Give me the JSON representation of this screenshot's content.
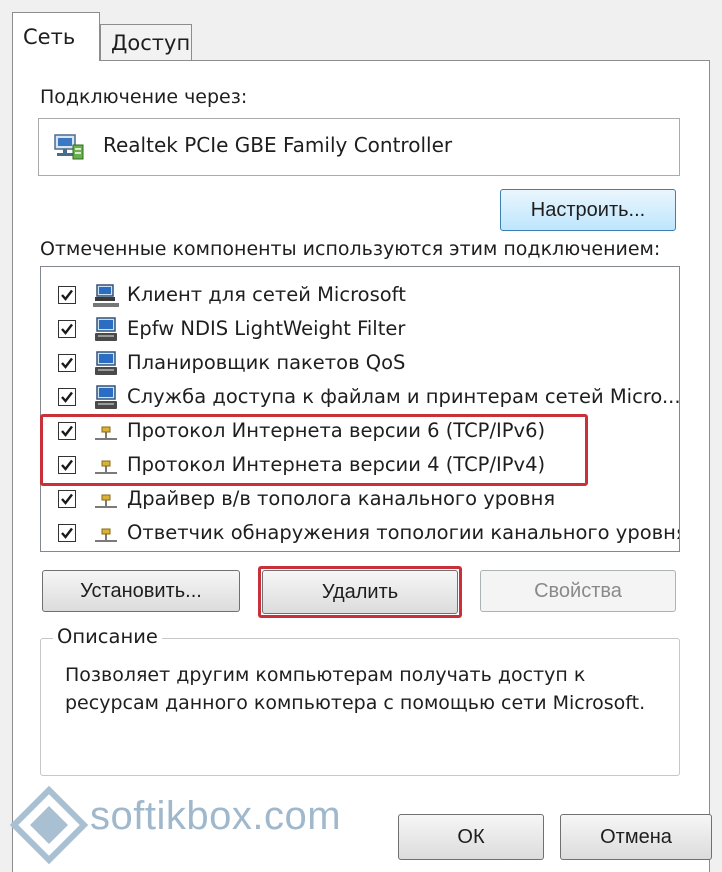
{
  "tabs": [
    {
      "label": "Сеть",
      "active": true
    },
    {
      "label": "Доступ",
      "active": false
    }
  ],
  "connect_using_label": "Подключение через:",
  "adapter": {
    "name": "Realtek PCIe GBE Family Controller",
    "icon": "network-adapter-icon"
  },
  "configure_button": "Настроить...",
  "components_label": "Отмеченные компоненты используются этим подключением:",
  "components": [
    {
      "label": "Клиент для сетей Microsoft",
      "checked": true,
      "icon": "network-client-icon"
    },
    {
      "label": "Epfw NDIS LightWeight Filter",
      "checked": true,
      "icon": "network-service-icon"
    },
    {
      "label": "Планировщик пакетов QoS",
      "checked": true,
      "icon": "network-service-icon"
    },
    {
      "label": "Служба доступа к файлам и принтерам сетей Micro...",
      "checked": true,
      "icon": "network-service-icon"
    },
    {
      "label": "Протокол Интернета версии 6 (TCP/IPv6)",
      "checked": true,
      "icon": "protocol-icon"
    },
    {
      "label": "Протокол Интернета версии 4 (TCP/IPv4)",
      "checked": true,
      "icon": "protocol-icon"
    },
    {
      "label": "Драйвер в/в тополога канального уровня",
      "checked": true,
      "icon": "protocol-icon"
    },
    {
      "label": "Ответчик обнаружения топологии канального уровня",
      "checked": true,
      "icon": "protocol-icon"
    }
  ],
  "buttons": {
    "install": "Установить...",
    "uninstall": "Удалить",
    "properties": "Свойства",
    "ok": "ОК",
    "cancel": "Отмена"
  },
  "description": {
    "legend": "Описание",
    "text": "Позволяет другим компьютерам получать доступ к ресурсам данного компьютера с помощью сети Microsoft."
  },
  "watermark": {
    "text": "softikbox.com"
  },
  "colors": {
    "highlight": "#c9303a",
    "focus_border": "#3c7fb1",
    "watermark": "#9fb8cc"
  }
}
